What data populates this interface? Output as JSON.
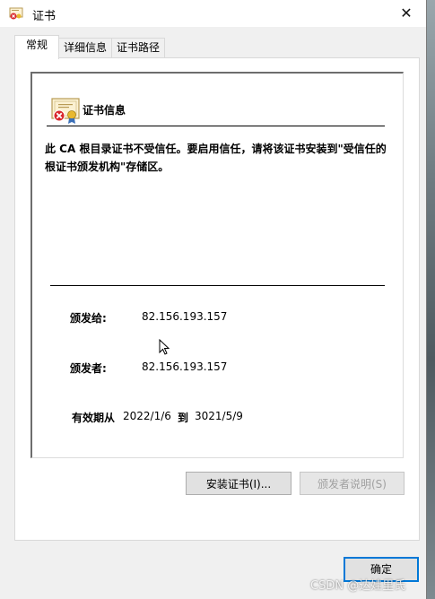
{
  "window": {
    "title": "证书",
    "close_glyph": "✕"
  },
  "tabs": [
    {
      "label": "常规",
      "active": true
    },
    {
      "label": "详细信息",
      "active": false
    },
    {
      "label": "证书路径",
      "active": false
    }
  ],
  "info": {
    "heading": "证书信息",
    "warning": "此 CA 根目录证书不受信任。要启用信任，请将该证书安装到\"受信任的根证书颁发机构\"存储区。",
    "issued_to_label": "颁发给:",
    "issued_to_value": "82.156.193.157",
    "issued_by_label": "颁发者:",
    "issued_by_value": "82.156.193.157",
    "validity_label": "有效期从",
    "valid_from": "2022/1/6",
    "to_label": "到",
    "valid_to": "3021/5/9"
  },
  "buttons": {
    "install": "安装证书(I)...",
    "issuer_statement": "颁发者说明(S)",
    "ok": "确定"
  },
  "watermark": "CSDN @达娃里氏",
  "icons": {
    "title": "certificate-error-icon",
    "cert": "certificate-untrusted-icon",
    "close": "close-icon"
  },
  "colors": {
    "accent": "#0078d7",
    "error": "#d9262b",
    "dialog_bg": "#f0f0f0"
  }
}
